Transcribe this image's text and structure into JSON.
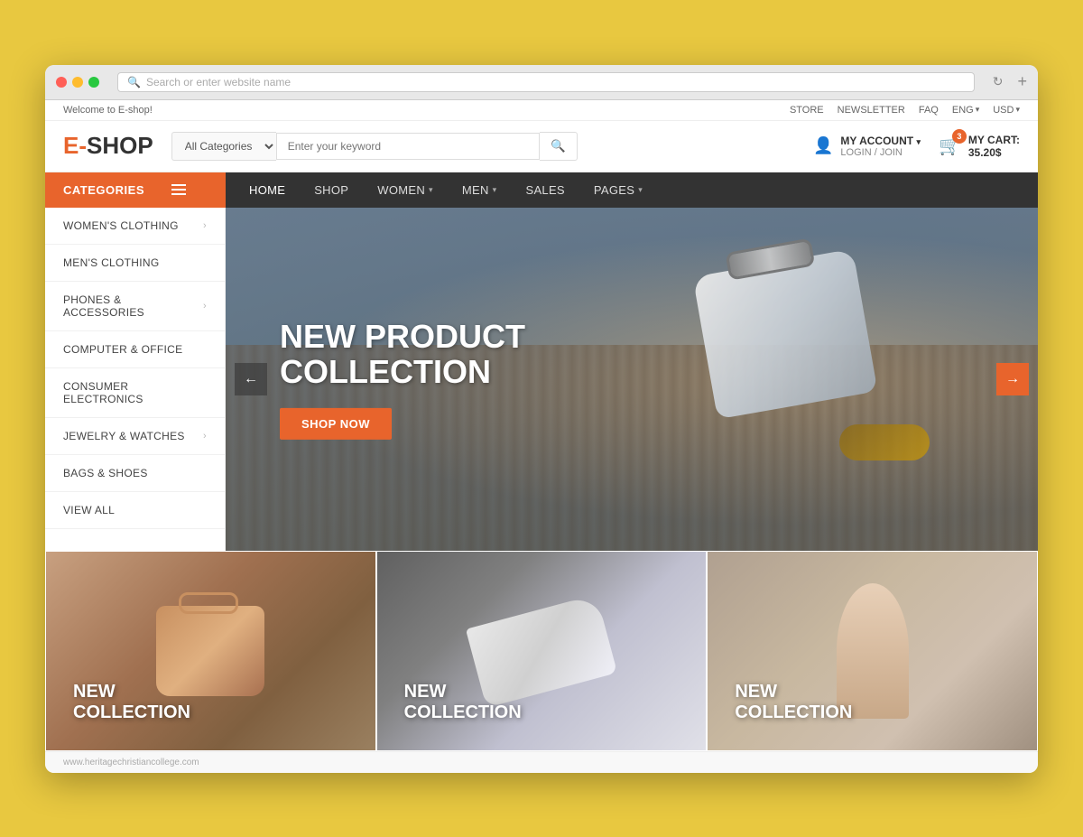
{
  "browser": {
    "address": "Search or enter website name",
    "add_tab": "+"
  },
  "topbar": {
    "welcome": "Welcome to E-shop!",
    "store": "STORE",
    "newsletter": "NEWSLETTER",
    "faq": "FAQ",
    "lang": "ENG",
    "currency": "USD"
  },
  "header": {
    "logo_e": "E-",
    "logo_shop": "SHOP",
    "category_default": "All Categories",
    "search_placeholder": "Enter your keyword",
    "account_title": "MY ACCOUNT",
    "account_sub": "LOGIN / JOIN",
    "cart_title": "MY CART:",
    "cart_total": "35.20$",
    "cart_count": "3"
  },
  "nav": {
    "categories_label": "CATEGORIES",
    "items": [
      {
        "label": "HOME",
        "has_dropdown": false
      },
      {
        "label": "SHOP",
        "has_dropdown": false
      },
      {
        "label": "WOMEN",
        "has_dropdown": true
      },
      {
        "label": "MEN",
        "has_dropdown": true
      },
      {
        "label": "SALES",
        "has_dropdown": false
      },
      {
        "label": "PAGES",
        "has_dropdown": true
      }
    ]
  },
  "sidebar": {
    "items": [
      {
        "label": "WOMEN'S CLOTHING",
        "has_arrow": true
      },
      {
        "label": "MEN'S CLOTHING",
        "has_arrow": false
      },
      {
        "label": "PHONES & ACCESSORIES",
        "has_arrow": true
      },
      {
        "label": "COMPUTER & OFFICE",
        "has_arrow": false
      },
      {
        "label": "CONSUMER ELECTRONICS",
        "has_arrow": false
      },
      {
        "label": "JEWELRY & WATCHES",
        "has_arrow": true
      },
      {
        "label": "BAGS & SHOES",
        "has_arrow": false
      },
      {
        "label": "VIEW ALL",
        "has_arrow": false
      }
    ]
  },
  "hero": {
    "title_line1": "NEW PRODUCT",
    "title_line2": "COLLECTION",
    "cta": "SHOP NOW",
    "prev_arrow": "←",
    "next_arrow": "→"
  },
  "collections": [
    {
      "title_line1": "NEW",
      "title_line2": "COLLECTION"
    },
    {
      "title_line1": "NEW",
      "title_line2": "COLLECTION"
    },
    {
      "title_line1": "NEW",
      "title_line2": "COLLECTION"
    }
  ],
  "footer": {
    "url": "www.heritagechristiancollege.com"
  }
}
